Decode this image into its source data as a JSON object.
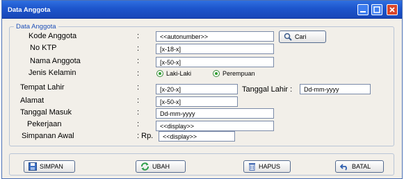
{
  "window": {
    "title": "Data Anggota"
  },
  "group": {
    "legend": "Data Anggota"
  },
  "form": {
    "kode_anggota": {
      "label": "Kode Anggota",
      "value": "<<autonumber>>"
    },
    "cari_label": "Cari",
    "no_ktp": {
      "label": "No KTP",
      "value": "[x-18-x]"
    },
    "nama_anggota": {
      "label": "Nama Anggota",
      "value": "[x-50-x]"
    },
    "jenis_kelamin": {
      "label": "Jenis Kelamin",
      "options": [
        "Laki-Laki",
        "Perempuan"
      ]
    },
    "tempat_lahir": {
      "label": "Tempat Lahir",
      "value": "[x-20-x]"
    },
    "tanggal_lahir": {
      "label": "Tanggal Lahir :",
      "value": "Dd-mm-yyyy"
    },
    "alamat": {
      "label": "Alamat",
      "value": "[x-50-x]"
    },
    "tanggal_masuk": {
      "label": "Tanggal Masuk",
      "value": "Dd-mm-yyyy"
    },
    "pekerjaan": {
      "label": "Pekerjaan",
      "value": "<<display>>"
    },
    "simpanan_awal": {
      "label": "Simpanan Awal",
      "currency": "Rp.",
      "value": "<<display>>"
    },
    "colon": ":"
  },
  "actions": {
    "simpan": "SIMPAN",
    "ubah": "UBAH",
    "hapus": "HAPUS",
    "batal": "BATAL"
  },
  "colors": {
    "titlebar": "#1d55cc",
    "legend": "#1d4fb8",
    "close": "#d9452a"
  },
  "icons": [
    "minimize-icon",
    "maximize-icon",
    "close-icon",
    "search-icon",
    "save-icon",
    "refresh-icon",
    "trash-icon",
    "undo-icon"
  ]
}
